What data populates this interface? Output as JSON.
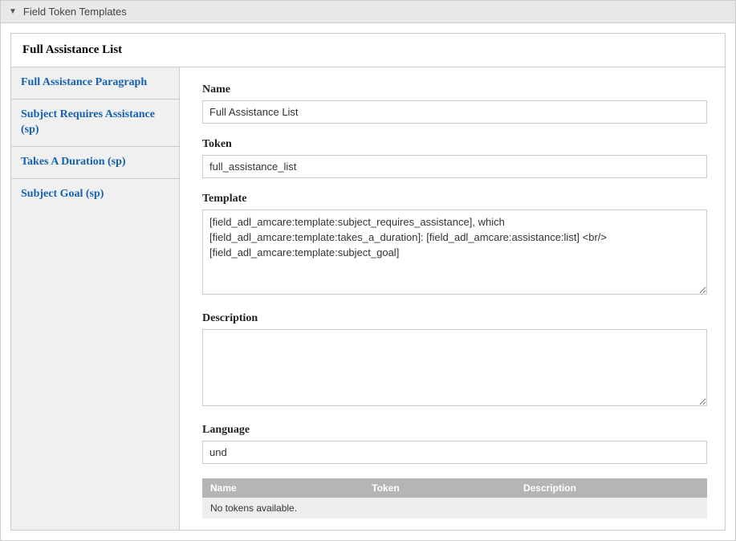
{
  "header": {
    "title": "Field Token Templates"
  },
  "panel": {
    "title": "Full Assistance List"
  },
  "tabs": [
    {
      "label": "Full Assistance Paragraph"
    },
    {
      "label": "Subject Requires Assistance (sp)"
    },
    {
      "label": "Takes A Duration (sp)"
    },
    {
      "label": "Subject Goal (sp)"
    }
  ],
  "form": {
    "name_label": "Name",
    "name_value": "Full Assistance List",
    "token_label": "Token",
    "token_value": "full_assistance_list",
    "template_label": "Template",
    "template_value": "[field_adl_amcare:template:subject_requires_assistance], which [field_adl_amcare:template:takes_a_duration]: [field_adl_amcare:assistance:list] <br/> [field_adl_amcare:template:subject_goal]",
    "description_label": "Description",
    "description_value": "",
    "language_label": "Language",
    "language_value": "und"
  },
  "token_table": {
    "headers": [
      "Name",
      "Token",
      "Description"
    ],
    "empty_message": "No tokens available."
  }
}
